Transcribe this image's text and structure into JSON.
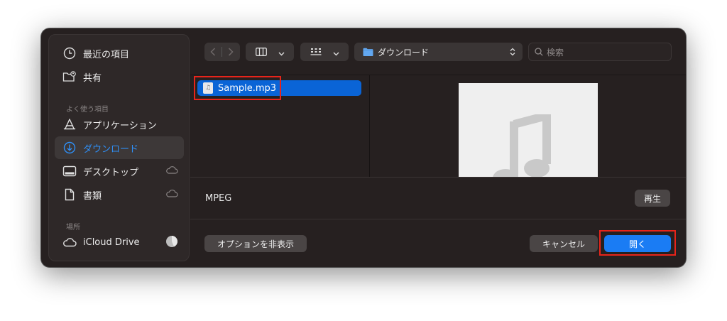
{
  "sidebar": {
    "items": [
      {
        "label": "最近の項目",
        "icon": "clock-icon"
      },
      {
        "label": "共有",
        "icon": "shared-folder-icon"
      }
    ],
    "favorites_header": "よく使う項目",
    "favorites": [
      {
        "label": "アプリケーション",
        "icon": "applications-icon"
      },
      {
        "label": "ダウンロード",
        "icon": "download-icon",
        "active": true
      },
      {
        "label": "デスクトップ",
        "icon": "desktop-icon",
        "cloud": true
      },
      {
        "label": "書類",
        "icon": "document-icon",
        "cloud": true
      }
    ],
    "locations_header": "場所",
    "locations": [
      {
        "label": "iCloud Drive",
        "icon": "cloud-icon"
      }
    ]
  },
  "toolbar": {
    "location": "ダウンロード",
    "search_placeholder": "検索"
  },
  "files": [
    {
      "name": "Sample.mp3",
      "selected": true
    }
  ],
  "preview": {
    "kind": "MPEG",
    "play_label": "再生"
  },
  "footer": {
    "options_label": "オプションを非表示",
    "cancel_label": "キャンセル",
    "open_label": "開く"
  },
  "colors": {
    "accent": "#1a7cf4",
    "selection": "#0a64d6",
    "highlight_box": "#e8241a"
  }
}
